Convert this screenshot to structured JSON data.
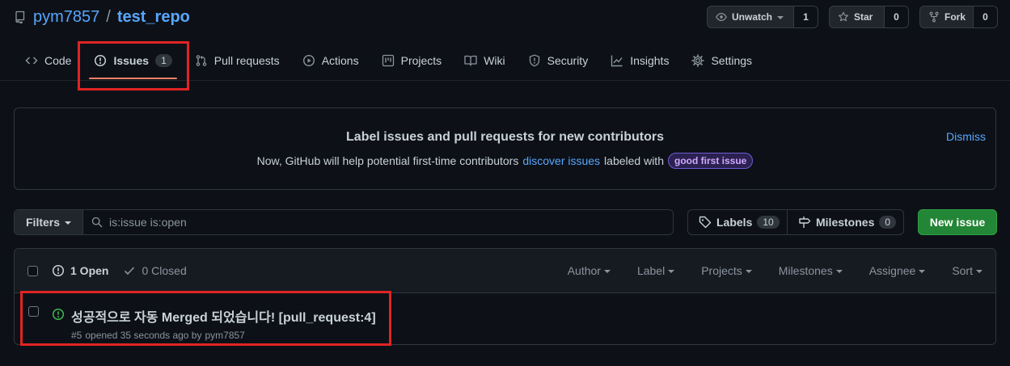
{
  "repo": {
    "owner": "pym7857",
    "separator": "/",
    "name": "test_repo"
  },
  "actions": {
    "watch": {
      "label": "Unwatch",
      "count": "1"
    },
    "star": {
      "label": "Star",
      "count": "0"
    },
    "fork": {
      "label": "Fork",
      "count": "0"
    }
  },
  "tabs": [
    {
      "label": "Code"
    },
    {
      "label": "Issues",
      "count": "1"
    },
    {
      "label": "Pull requests"
    },
    {
      "label": "Actions"
    },
    {
      "label": "Projects"
    },
    {
      "label": "Wiki"
    },
    {
      "label": "Security"
    },
    {
      "label": "Insights"
    },
    {
      "label": "Settings"
    }
  ],
  "banner": {
    "title": "Label issues and pull requests for new contributors",
    "sub_before": "Now, GitHub will help potential first-time contributors",
    "link": "discover issues",
    "sub_after": "labeled with",
    "label_chip": "good first issue",
    "dismiss": "Dismiss"
  },
  "filter_bar": {
    "filters_label": "Filters",
    "search_value": "is:issue is:open",
    "labels_label": "Labels",
    "labels_count": "10",
    "milestones_label": "Milestones",
    "milestones_count": "0",
    "new_issue_label": "New issue"
  },
  "list": {
    "open_label": "1 Open",
    "closed_label": "0 Closed",
    "column_filters": [
      "Author",
      "Label",
      "Projects",
      "Milestones",
      "Assignee",
      "Sort"
    ],
    "issues": [
      {
        "title": "성공적으로 자동 Merged 되었습니다! [pull_request:4]",
        "number": "#5",
        "opened": "opened 35 seconds ago by",
        "author": "pym7857"
      }
    ]
  },
  "colors": {
    "background": "#0d1117",
    "link": "#58a6ff",
    "tab_underline": "#f78166",
    "open_green": "#3fb950",
    "new_issue_green": "#238636",
    "highlight_red": "#e02424"
  }
}
